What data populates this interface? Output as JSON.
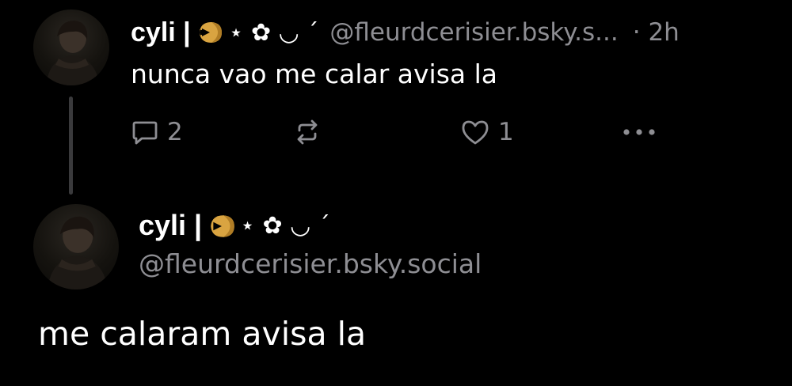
{
  "parent_post": {
    "display_name": "cyli |",
    "name_decor": "⋆ ✿ ◡ ˊ",
    "name_emoji": "fortune-cookie-emoji",
    "handle": "@fleurdcerisier.bsky.s...",
    "time": "· 2h",
    "text": "nunca vao me calar avisa la",
    "actions": {
      "reply_count": "2",
      "repost_count": "",
      "like_count": "1"
    }
  },
  "main_post": {
    "display_name": "cyli |",
    "name_decor": "⋆ ✿ ◡ ˊ",
    "name_emoji": "fortune-cookie-emoji",
    "handle": "@fleurdcerisier.bsky.social",
    "text": "me calaram avisa la"
  },
  "colors": {
    "background": "#000000",
    "primary_text": "#ffffff",
    "secondary_text": "#8e8e93",
    "thread_line": "#3a3a3c",
    "cookie": "#d9a441"
  }
}
